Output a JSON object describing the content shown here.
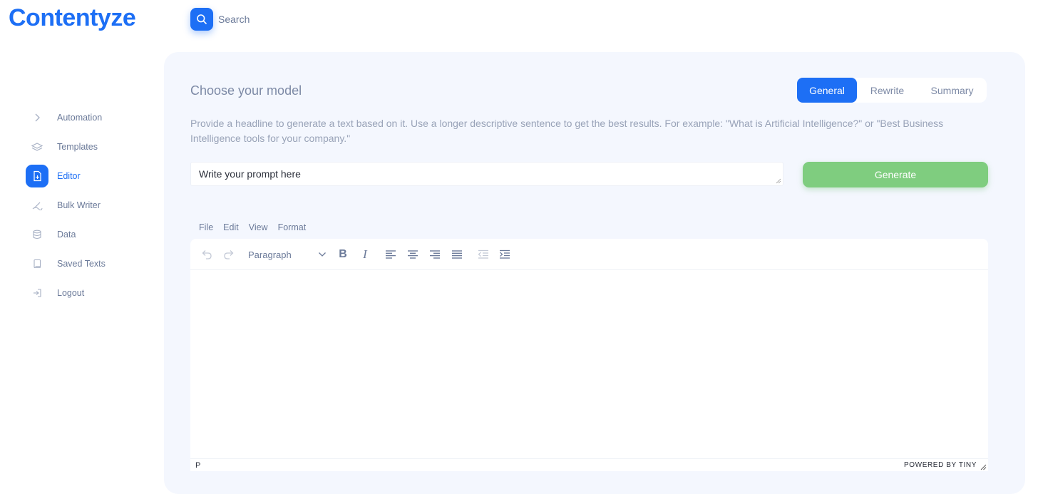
{
  "app": {
    "logo": "Contentyze"
  },
  "search": {
    "label": "Search"
  },
  "sidebar": {
    "items": [
      {
        "label": "Automation",
        "icon": "chevron-right-icon"
      },
      {
        "label": "Templates",
        "icon": "layers-icon"
      },
      {
        "label": "Editor",
        "icon": "document-icon",
        "active": true
      },
      {
        "label": "Bulk Writer",
        "icon": "pen-icon"
      },
      {
        "label": "Data",
        "icon": "database-icon"
      },
      {
        "label": "Saved Texts",
        "icon": "book-icon"
      },
      {
        "label": "Logout",
        "icon": "logout-icon"
      }
    ]
  },
  "main": {
    "title": "Choose your model",
    "tabs": [
      {
        "label": "General",
        "active": true
      },
      {
        "label": "Rewrite"
      },
      {
        "label": "Summary"
      }
    ],
    "description": "Provide a headline to generate a text based on it. Use a longer descriptive sentence to get the best results. For example: \"What is Artificial Intelligence?\" or \"Best Business Intelligence tools for your company.\"",
    "prompt_placeholder": "Write your prompt here",
    "generate_label": "Generate"
  },
  "editor": {
    "menu": [
      "File",
      "Edit",
      "View",
      "Format"
    ],
    "block_format": "Paragraph",
    "status_path": "P",
    "powered_by": "POWERED BY TINY"
  },
  "colors": {
    "accent": "#1d6ff5",
    "panel_bg": "#f4f7fe",
    "generate_btn": "#7fcd7f",
    "muted_text": "#7d8aa6"
  }
}
